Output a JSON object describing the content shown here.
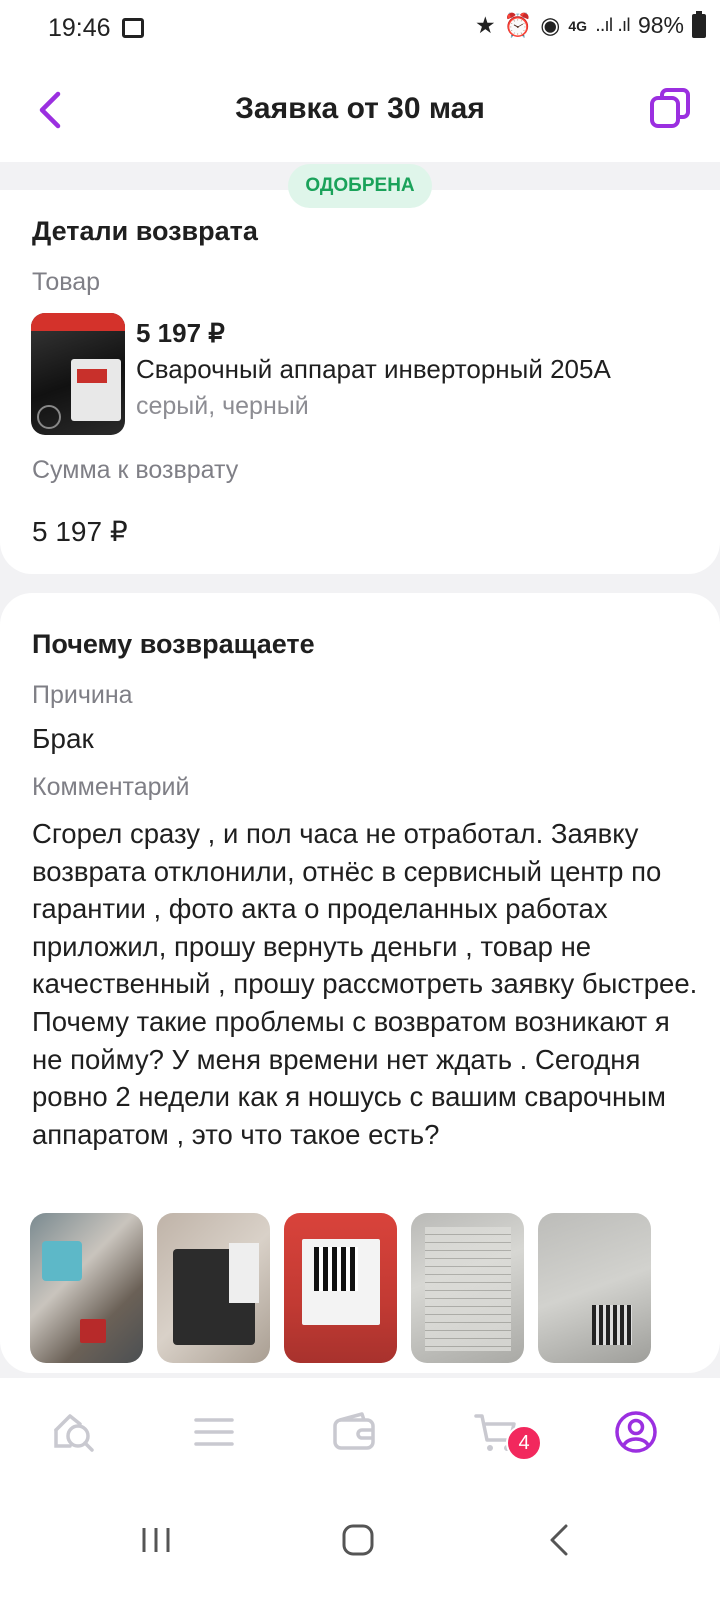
{
  "status_bar": {
    "time": "19:46",
    "network": "4G",
    "signal": "..ıl .ıl",
    "battery": "98%"
  },
  "header": {
    "title": "Заявка от 30 мая"
  },
  "status_badge": "ОДОБРЕНА",
  "return_details": {
    "title": "Детали возврата",
    "product_label": "Товар",
    "product": {
      "price": "5 197 ₽",
      "name": "Сварочный аппарат инверторный 205А",
      "variant": "серый, черный"
    },
    "refund_label": "Сумма к возврату",
    "refund_value": "5 197 ₽"
  },
  "reason_section": {
    "title": "Почему возвращаете",
    "reason_label": "Причина",
    "reason_value": "Брак",
    "comment_label": "Комментарий",
    "comment": "Сгорел сразу , и пол часа не отработал. Заявку возврата отклонили, отнёс в сервисный центр по гарантии , фото акта о проделанных работах приложил, прошу вернуть деньги , товар не качественный , прошу рассмотреть заявку быстрее. Почему такие проблемы с возвратом возникают я не пойму? У меня времени нет ждать . Сегодня ровно 2 недели как я ношусь с вашим сварочным аппаратом , это что такое есть?"
  },
  "bottom_nav": {
    "cart_count": "4"
  },
  "colors": {
    "accent": "#9b2fe0",
    "badge_bg": "#dff5ea",
    "badge_text": "#1aa25a",
    "cart_badge": "#f2285d",
    "nav_icon": "#c9c9d0"
  }
}
